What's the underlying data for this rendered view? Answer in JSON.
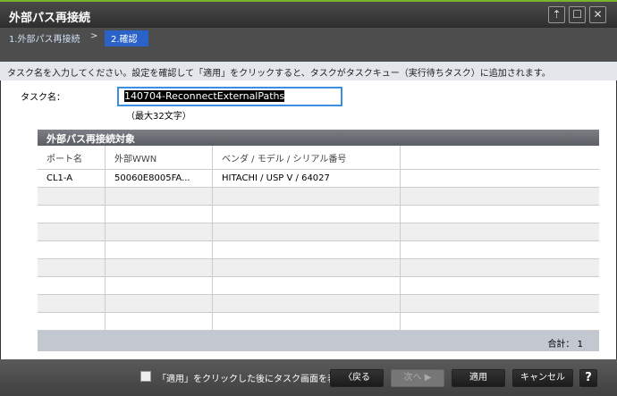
{
  "window": {
    "title": "外部パス再接続",
    "pin_icon": "pin-icon",
    "maximize_icon": "maximize-icon",
    "close_icon": "close-icon"
  },
  "breadcrumb": [
    {
      "label": "1.外部パス再接続"
    },
    {
      "label": ">"
    },
    {
      "label": "2.確認",
      "active": true
    }
  ],
  "info": "タスク名を入力してください。設定を確認して「適用」をクリックすると、タスクがタスクキュー（実行待ちタスク）に追加されます。",
  "task": {
    "label": "タスク名：",
    "value": "140704-ReconnectExternalPaths",
    "hint": "（最大32文字）"
  },
  "table": {
    "title": "外部パス再接続対象",
    "columns": [
      "ポート名",
      "外部WWN",
      "ベンダ / モデル / シリアル番号",
      ""
    ],
    "rows": [
      [
        "CL1-A",
        "50060E8005FA...",
        "HITACHI / USP V / 64027",
        ""
      ]
    ],
    "total_label": "合計：",
    "total": "1"
  },
  "footer": {
    "checkbox_label": "「適用」をクリックした後にタスク画面を表示",
    "checked": false,
    "back": "戻る",
    "next": "次へ",
    "apply": "適用",
    "cancel": "キャンセル",
    "help": "?"
  }
}
